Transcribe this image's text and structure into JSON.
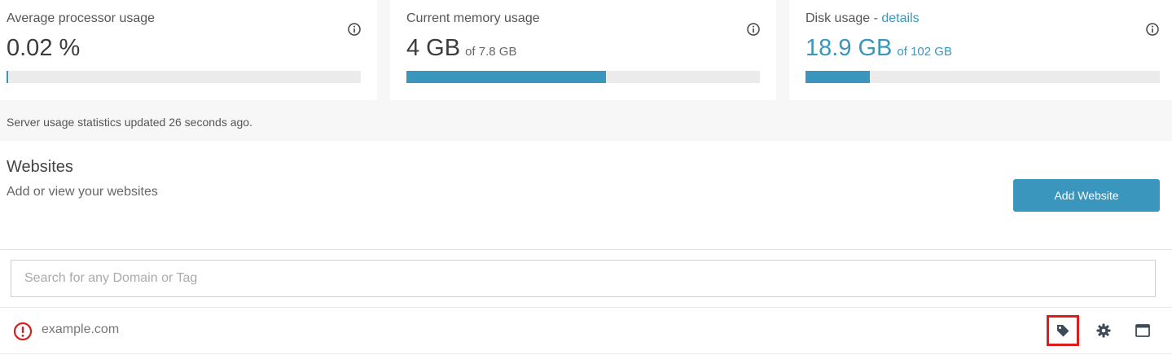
{
  "stats": {
    "processor": {
      "label": "Average processor usage",
      "value": "0.02 %",
      "usage_percent": 0.4
    },
    "memory": {
      "label": "Current memory usage",
      "value": "4 GB",
      "of_text": "of 7.8 GB",
      "usage_percent": 56.5
    },
    "disk": {
      "label_prefix": "Disk usage - ",
      "label_link": "details",
      "value": "18.9 GB",
      "of_text": "of 102 GB",
      "usage_percent": 18.2
    }
  },
  "status_text": "Server usage statistics updated 26 seconds ago.",
  "websites": {
    "title": "Websites",
    "subtitle": "Add or view your websites",
    "add_button_label": "Add Website",
    "search_placeholder": "Search for any Domain or Tag",
    "items": [
      {
        "domain": "example.com",
        "status_icon": "warning-icon"
      }
    ]
  },
  "colors": {
    "accent": "#3a96bc",
    "warning": "#d62020",
    "highlight": "#e01b1b"
  }
}
